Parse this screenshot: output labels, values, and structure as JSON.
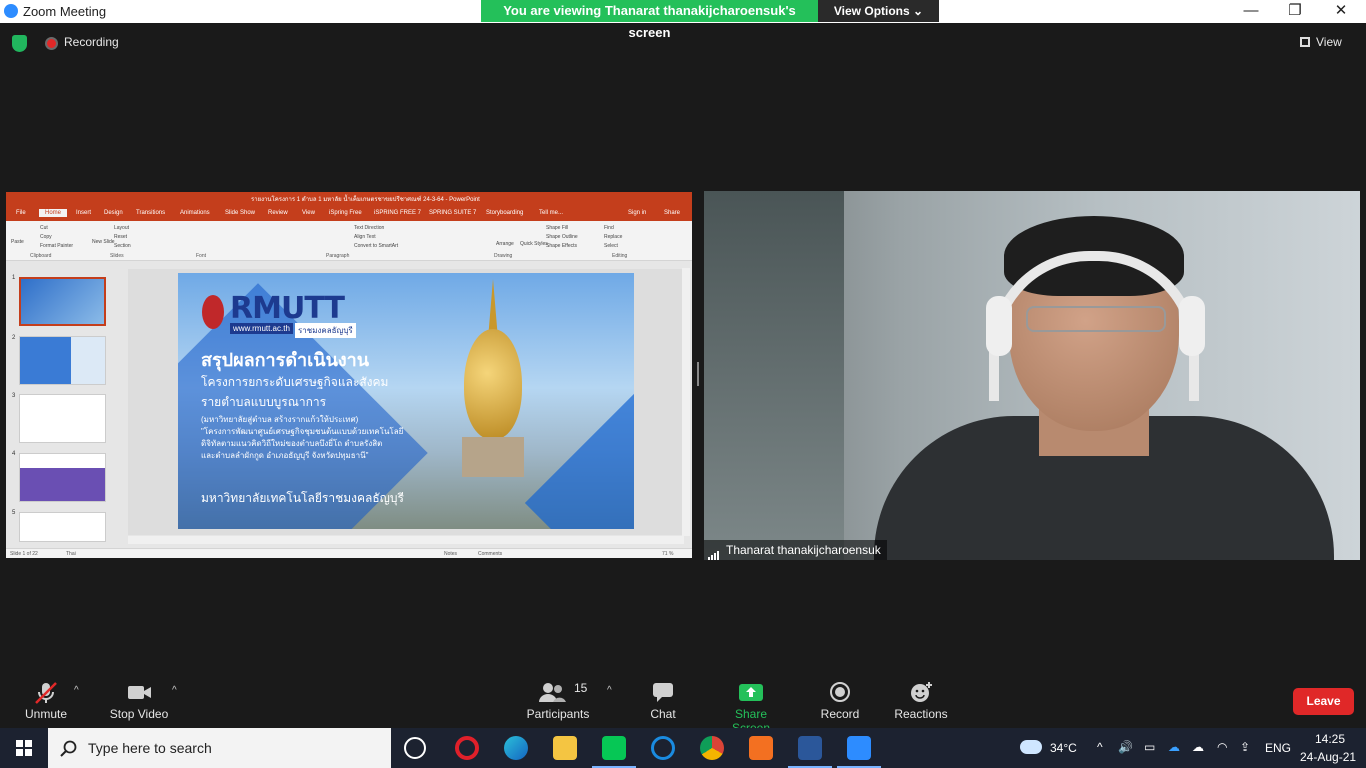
{
  "window": {
    "title": "Zoom Meeting",
    "minimize": "—",
    "restore": "❐",
    "close": "✕"
  },
  "banner": {
    "text": "You are viewing Thanarat thanakijcharoensuk's screen",
    "view_options": "View Options"
  },
  "top": {
    "recording": "Recording",
    "view": "View"
  },
  "powerpoint": {
    "title": "รายงานโครงการ 1 ตำบล 1 มหาลัย น้ำเค็มเกษตรชาขยปรีชาศณฑ์ 24-3-64 - PowerPoint",
    "tabs": [
      "File",
      "Home",
      "Insert",
      "Design",
      "Transitions",
      "Animations",
      "Slide Show",
      "Review",
      "View",
      "iSpring Free",
      "iSPRING FREE 7",
      "SPRING SUITE 7",
      "Storyboarding",
      "Tell me..."
    ],
    "sign_in": "Sign in",
    "share": "Share",
    "groups": [
      "Clipboard",
      "Slides",
      "Font",
      "Paragraph",
      "Drawing",
      "Editing"
    ],
    "ribbon_items": {
      "paste": "Paste",
      "cut": "Cut",
      "copy": "Copy",
      "format_painter": "Format Painter",
      "new_slide": "New Slide",
      "layout": "Layout",
      "reset": "Reset",
      "section": "Section",
      "text_direction": "Text Direction",
      "align_text": "Align Text",
      "convert_smartart": "Convert to SmartArt",
      "arrange": "Arrange",
      "quick_styles": "Quick Styles",
      "shape_fill": "Shape Fill",
      "shape_outline": "Shape Outline",
      "shape_effects": "Shape Effects",
      "find": "Find",
      "replace": "Replace",
      "select": "Select"
    },
    "thumb_numbers": [
      "1",
      "2",
      "3",
      "4",
      "5"
    ],
    "slide": {
      "logo": "RMUTT",
      "url": "www.rmutt.ac.th",
      "logo_sub": "ราชมงคลธัญบุรี",
      "heading": "สรุปผลการดำเนินงาน",
      "line1": "โครงการยกระดับเศรษฐกิจและสังคม",
      "line2": "รายตำบลแบบบูรณาการ",
      "p1": "(มหาวิทยาลัยสู่ตำบล สร้างรากแก้วให้ประเทศ)",
      "p2": "\"โครงการพัฒนาศูนย์เศรษฐกิจชุมชนต้นแบบด้วยเทคโนโลยี",
      "p3": "ดิจิทัลตามแนวคิดวิถีใหม่ของตำบลบึงยี่โถ ตำบลรังสิต",
      "p4": "และตำบลลำผักกูด อำเภอธัญบุรี จังหวัดปทุมธานี\"",
      "footer": "มหาวิทยาลัยเทคโนโลยีราชมงคลธัญบุรี"
    },
    "status": {
      "slide": "Slide 1 of 22",
      "lang": "Thai",
      "notes": "Notes",
      "comments": "Comments",
      "zoom": "71 %"
    }
  },
  "participant": {
    "name": "Thanarat thanakijcharoensuk"
  },
  "toolbar": {
    "unmute": "Unmute",
    "stop_video": "Stop Video",
    "participants": "Participants",
    "participants_count": "15",
    "chat": "Chat",
    "share_screen": "Share Screen",
    "record": "Record",
    "reactions": "Reactions",
    "leave": "Leave"
  },
  "taskbar": {
    "search_placeholder": "Type here to search",
    "weather": "34°C",
    "lang": "ENG",
    "time": "14:25",
    "date": "24-Aug-21"
  },
  "colors": {
    "zoom_blue": "#2d8cff",
    "banner_green": "#24c05a",
    "leave_red": "#e02828",
    "ppt_red": "#c43e1c"
  }
}
